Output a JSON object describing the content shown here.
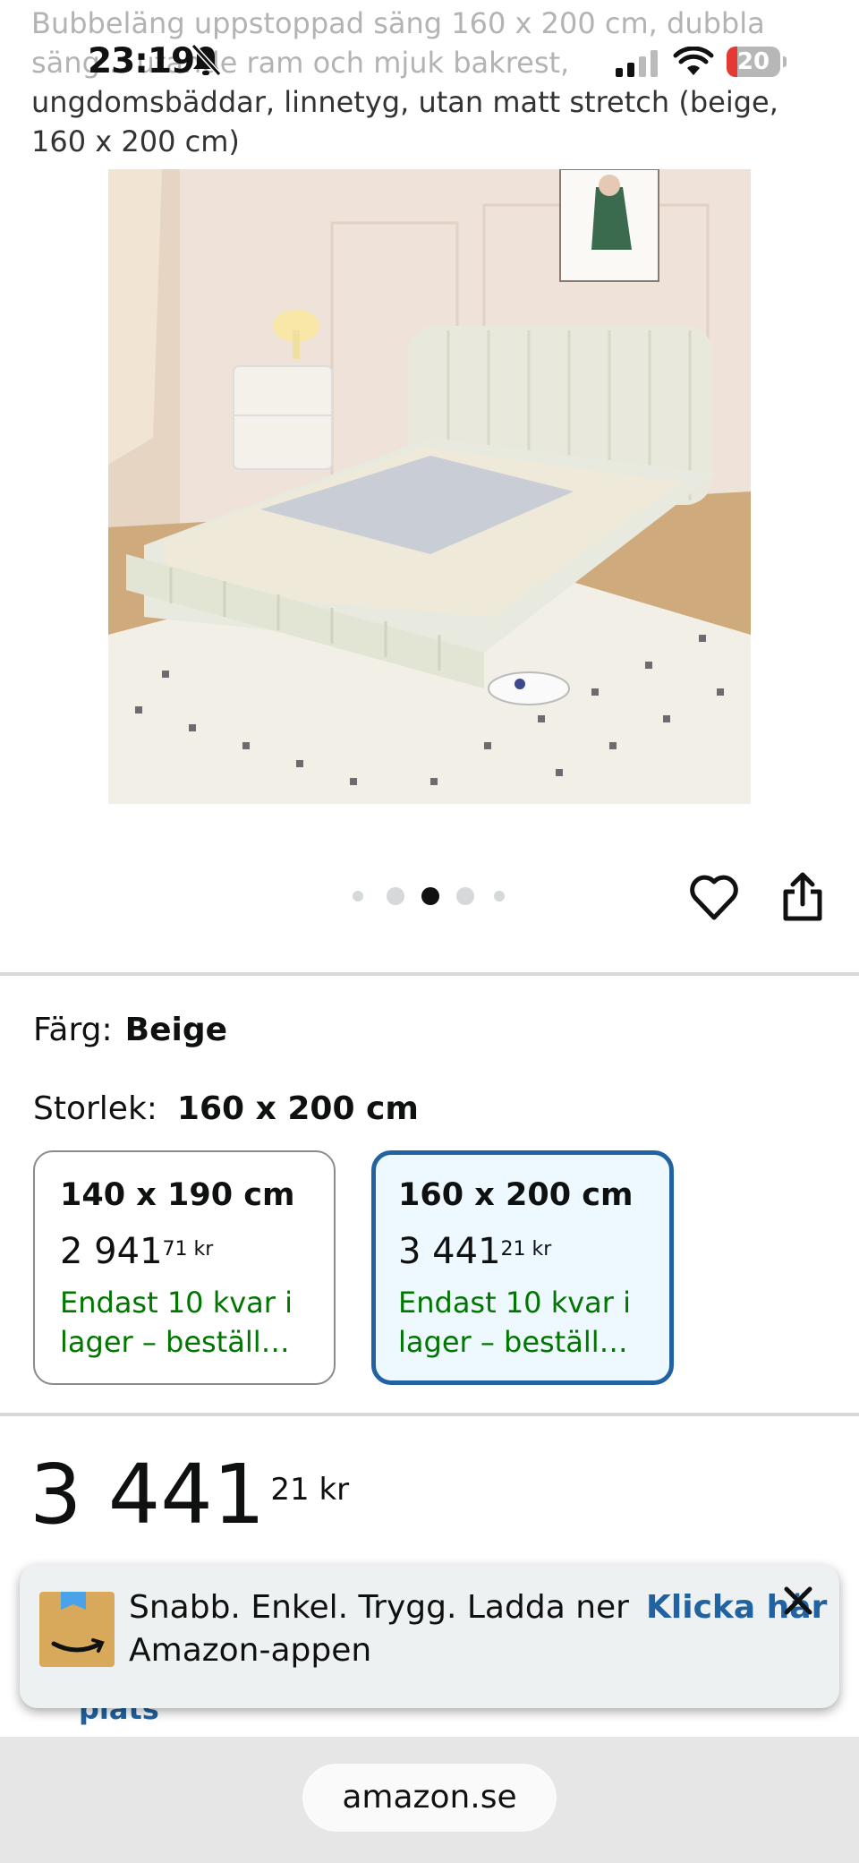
{
  "product": {
    "title_faded": "Bubbeläng uppstoppad säng 160 x 200 cm, dubbla säng... utande ram och mjuk bakrest,",
    "title_dark": "ungdomsbäddar, linnetyg, utan matt stretch (beige, 160 x 200 cm)"
  },
  "status_bar": {
    "time": "23:19",
    "battery": "20"
  },
  "gallery": {
    "dot_count": 5,
    "active_index": 2
  },
  "variants": {
    "color_label": "Färg:",
    "color_value": "Beige",
    "size_label": "Storlek:",
    "size_value": "160 x 200 cm",
    "options": [
      {
        "name": "140 x 190 cm",
        "price_whole": "2 941",
        "price_fraction": "71",
        "currency": "kr",
        "stock": "Endast 10 kvar i lager – beställ…"
      },
      {
        "name": "160 x 200 cm",
        "price_whole": "3 441",
        "price_fraction": "21",
        "currency": "kr",
        "stock": "Endast 10 kvar i lager – beställ…"
      }
    ]
  },
  "price": {
    "whole": "3 441",
    "fraction": "21",
    "currency": "kr"
  },
  "obscured_text": "plats",
  "app_banner": {
    "text": "Snabb. Enkel. Trygg. Ladda ner Amazon-appen",
    "link": "Klicka här"
  },
  "browser": {
    "url": "amazon.se"
  },
  "colors": {
    "link_blue": "#2162a1",
    "stock_green": "#007600",
    "selected_bg": "#edf8ff"
  }
}
